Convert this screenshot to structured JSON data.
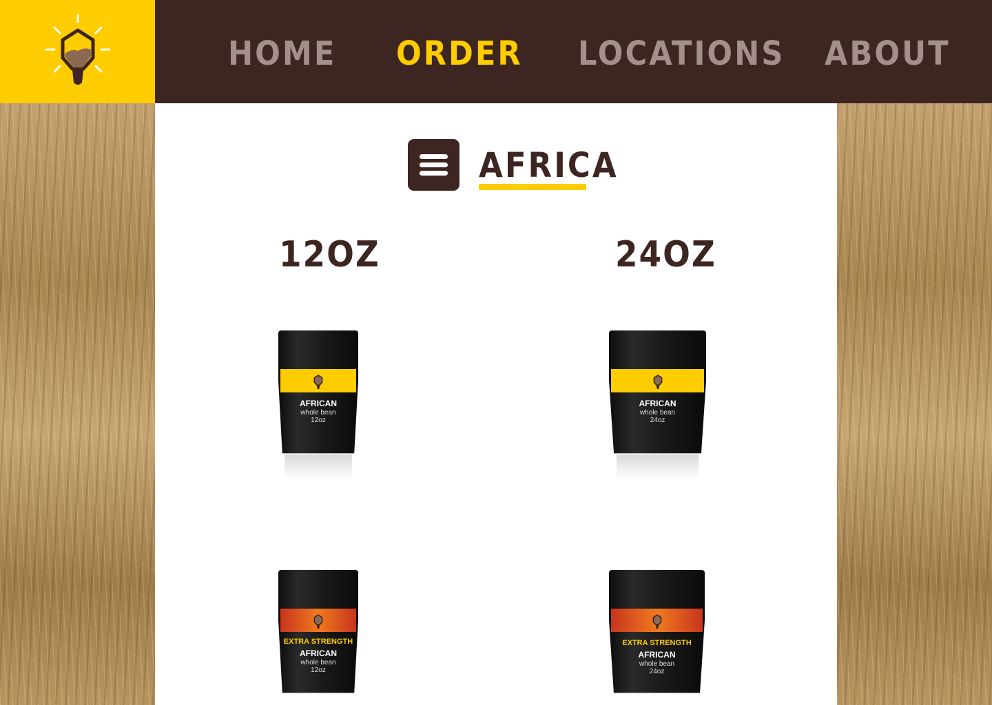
{
  "logo": {
    "icon": "lightbulb-coffee-icon",
    "color": "#ffcc00"
  },
  "nav": {
    "items": [
      {
        "label": "HOME",
        "active": false
      },
      {
        "label": "ORDER",
        "active": true
      },
      {
        "label": "LOCATIONS",
        "active": false
      },
      {
        "label": "ABOUT",
        "active": false
      }
    ]
  },
  "colors": {
    "header_bg": "#3d2521",
    "accent": "#ffcc00",
    "nav_inactive": "#a38f8b"
  },
  "main": {
    "menu_icon": "hamburger-icon",
    "region_title": "AFRICA",
    "sizes": [
      "12OZ",
      "24OZ"
    ],
    "products": [
      {
        "strength": "",
        "name": "AFRICAN",
        "type": "whole bean",
        "size": "12oz",
        "band": "yellow"
      },
      {
        "strength": "",
        "name": "AFRICAN",
        "type": "whole bean",
        "size": "24oz",
        "band": "yellow"
      },
      {
        "strength": "EXTRA STRENGTH",
        "name": "AFRICAN",
        "type": "whole bean",
        "size": "12oz",
        "band": "red"
      },
      {
        "strength": "EXTRA STRENGTH",
        "name": "AFRICAN",
        "type": "whole bean",
        "size": "24oz",
        "band": "red"
      }
    ]
  }
}
